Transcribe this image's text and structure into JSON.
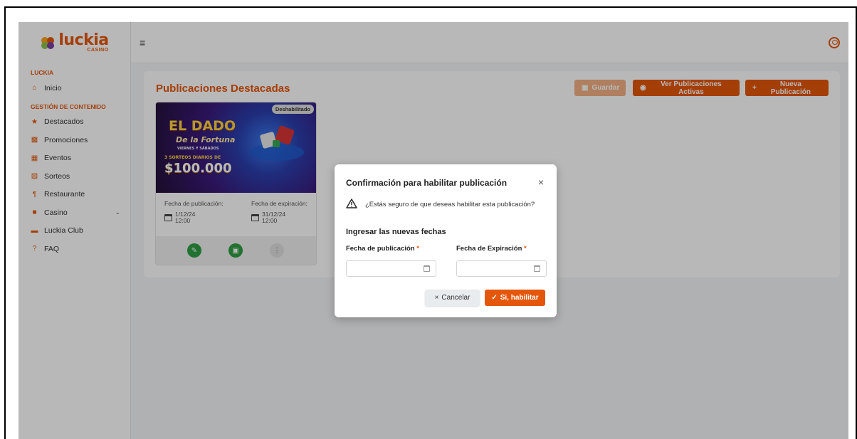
{
  "sidebar": {
    "logo_text": "luckia",
    "logo_sub": "CASINO",
    "sections": [
      "LUCKIA",
      "GESTIÓN DE CONTENIDO"
    ],
    "items": [
      {
        "label": "Inicio",
        "icon": "home-icon"
      },
      {
        "label": "Destacados",
        "icon": "star-icon"
      },
      {
        "label": "Promociones",
        "icon": "ticket-icon"
      },
      {
        "label": "Eventos",
        "icon": "calendar-icon"
      },
      {
        "label": "Sorteos",
        "icon": "gift-icon"
      },
      {
        "label": "Restaurante",
        "icon": "utensils-icon"
      },
      {
        "label": "Casino",
        "icon": "cards-icon"
      },
      {
        "label": "Luckia Club",
        "icon": "card-icon"
      },
      {
        "label": "FAQ",
        "icon": "question-icon"
      }
    ]
  },
  "topbar": {
    "menu_icon": "hamburger-icon",
    "profile_icon": "user-circle-icon"
  },
  "page": {
    "title": "Publicaciones Destacadas",
    "buttons": {
      "save": "Guardar",
      "view_active": "Ver Publicaciones Activas",
      "new": "Nueva Publicación"
    }
  },
  "card": {
    "badge": "Deshabilitado",
    "image_text": {
      "headline_1": "EL DADO",
      "headline_2": "De la Fortuna",
      "days": "VIERNES Y SÁBADOS",
      "draws": "3 SORTEOS DIARIOS DE",
      "amount": "$100.000"
    },
    "publish_label": "Fecha de publicación:",
    "publish_date": "1/12/24",
    "publish_time": "12:00",
    "expire_label": "Fecha de expiración:",
    "expire_date": "31/12/24",
    "expire_time": "12:00"
  },
  "modal": {
    "title": "Confirmación para habilitar publicación",
    "question": "¿Estás seguro de que deseas habilitar esta publicación?",
    "subtitle": "Ingresar las nuevas fechas",
    "pub_label": "Fecha de publicación",
    "exp_label": "Fecha de Expiración",
    "required_mark": "*",
    "cancel": "Cancelar",
    "confirm": "Si, habilitar"
  },
  "colors": {
    "accent": "#e4570a",
    "green": "#2e9e44"
  }
}
